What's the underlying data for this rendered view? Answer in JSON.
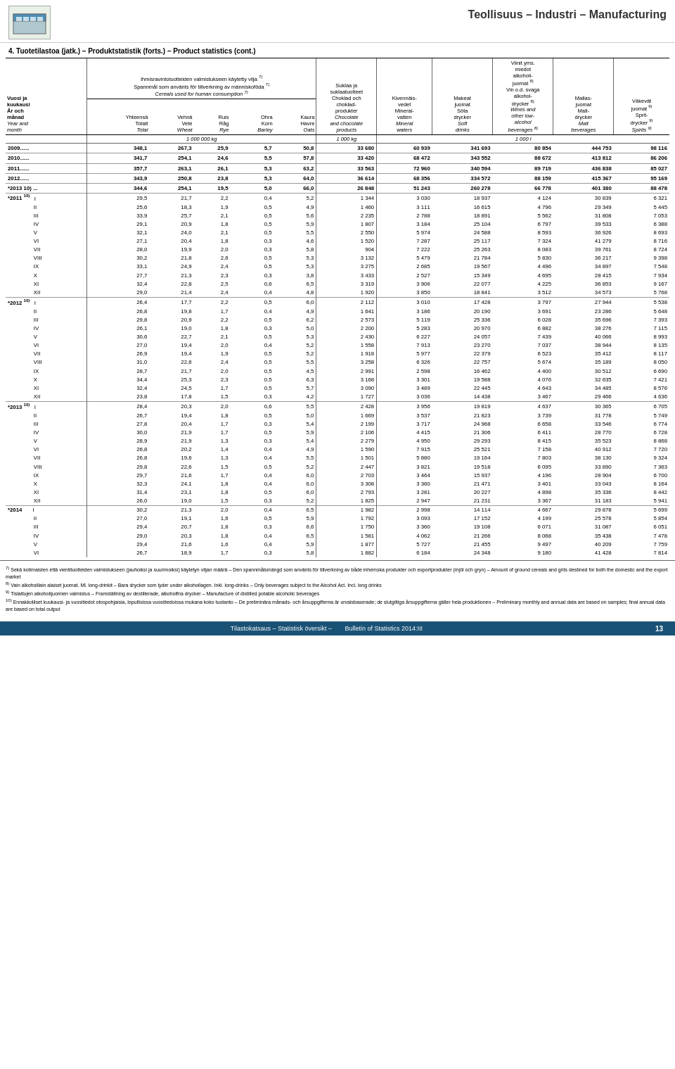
{
  "header": {
    "title": "Teollisuus – Industri – Manufacturing",
    "page_title": "4.  Tuotetilastoa (jatk.) – Produktstatistik (forts.) – Product statistics (cont.)"
  },
  "columns": {
    "year_month": {
      "fi": "Vuosi ja kuukausi",
      "sv": "År och månad",
      "en": "Year and month"
    },
    "total": {
      "fi": "Yhteensä Totalt",
      "sv": "Total",
      "en": "Total"
    },
    "wheat": {
      "fi": "Vehnä Vete",
      "sv": "Wheat"
    },
    "rye": {
      "fi": "Ruis Råg",
      "sv": "Rye"
    },
    "barley": {
      "fi": "Ohra Korn",
      "sv": "Barley"
    },
    "oats": {
      "fi": "Kaura Havre",
      "sv": "Oats"
    },
    "chocolate": {
      "fi": "Suklaa ja suklaatuotteet Choklad och chokladprodukter",
      "en": "Chocolate and chocolate products"
    },
    "mineral": {
      "fi": "Kivennäisvedet Mineralvatten",
      "en": "Mineral waters"
    },
    "soft": {
      "fi": "Makeat juomat Söta drycker",
      "en": "Soft drinks"
    },
    "wines": {
      "fi": "Viinit yms. miedot alkoholijuomat",
      "en": "Wines and other low-alcohol beverages"
    },
    "malt": {
      "fi": "Mallasjuomat Malt-drycker",
      "en": "Malt beverages"
    },
    "spirits": {
      "fi": "Väkevät juomat",
      "en": "Spirits"
    }
  },
  "units": {
    "cereals": "1 000 000 kg",
    "chocolate": "1 000 kg",
    "beverages": "1 000 l"
  },
  "data": {
    "years": [
      {
        "year": "2009......",
        "total": "348,1",
        "wheat": "267,3",
        "rye": "25,9",
        "barley": "5,7",
        "oats": "50,8",
        "chocolate": "33 680",
        "mineral": "60 939",
        "soft": "341 693",
        "wines": "80 854",
        "malt": "444 753",
        "spirits": "98 116"
      },
      {
        "year": "2010......",
        "total": "341,7",
        "wheat": "254,1",
        "rye": "24,6",
        "barley": "5,5",
        "oats": "57,8",
        "chocolate": "33 420",
        "mineral": "68 472",
        "soft": "343 552",
        "wines": "88 672",
        "malt": "413 812",
        "spirits": "86 206"
      },
      {
        "year": "2011......",
        "total": "357,7",
        "wheat": "263,1",
        "rye": "26,1",
        "barley": "5,3",
        "oats": "63,2",
        "chocolate": "33 563",
        "mineral": "72 960",
        "soft": "340 594",
        "wines": "89 719",
        "malt": "436 838",
        "spirits": "85 027"
      },
      {
        "year": "2012......",
        "total": "343,9",
        "wheat": "250,8",
        "rye": "23,8",
        "barley": "5,3",
        "oats": "64,0",
        "chocolate": "36 614",
        "mineral": "68 356",
        "soft": "334 572",
        "wines": "88 159",
        "malt": "415 367",
        "spirits": "95 169"
      },
      {
        "year": "*2013 10) ...",
        "total": "344,6",
        "wheat": "254,1",
        "rye": "19,5",
        "barley": "5,0",
        "oats": "66,0",
        "chocolate": "26 848",
        "mineral": "51 243",
        "soft": "260 278",
        "wines": "66 778",
        "malt": "401 380",
        "spirits": "88 478"
      }
    ],
    "months_2011": [
      {
        "month": "I",
        "total": "29,5",
        "wheat": "21,7",
        "rye": "2,2",
        "barley": "0,4",
        "oats": "5,2",
        "chocolate": "1 344",
        "mineral": "3 030",
        "soft": "18 937",
        "wines": "4 124",
        "malt": "30 839",
        "spirits": "6 321"
      },
      {
        "month": "II",
        "total": "25,6",
        "wheat": "18,3",
        "rye": "1,9",
        "barley": "0,5",
        "oats": "4,9",
        "chocolate": "1 460",
        "mineral": "3 111",
        "soft": "16 615",
        "wines": "4 796",
        "malt": "29 349",
        "spirits": "5 445"
      },
      {
        "month": "III",
        "total": "33,9",
        "wheat": "25,7",
        "rye": "2,1",
        "barley": "0,5",
        "oats": "5,6",
        "chocolate": "2 235",
        "mineral": "2 788",
        "soft": "18 891",
        "wines": "5 562",
        "malt": "31 808",
        "spirits": "7 053"
      },
      {
        "month": "IV",
        "total": "29,1",
        "wheat": "20,9",
        "rye": "1,8",
        "barley": "0,5",
        "oats": "5,9",
        "chocolate": "1 807",
        "mineral": "3 184",
        "soft": "25 104",
        "wines": "6 797",
        "malt": "39 533",
        "spirits": "6 388"
      },
      {
        "month": "V",
        "total": "32,1",
        "wheat": "24,0",
        "rye": "2,1",
        "barley": "0,5",
        "oats": "5,5",
        "chocolate": "2 550",
        "mineral": "5 974",
        "soft": "24 588",
        "wines": "8 593",
        "malt": "36 926",
        "spirits": "8 693"
      },
      {
        "month": "VI",
        "total": "27,1",
        "wheat": "20,4",
        "rye": "1,8",
        "barley": "0,3",
        "oats": "4,6",
        "chocolate": "1 520",
        "mineral": "7 287",
        "soft": "25 117",
        "wines": "7 324",
        "malt": "41 279",
        "spirits": "8 716"
      },
      {
        "month": "VII",
        "total": "28,0",
        "wheat": "19,9",
        "rye": "2,0",
        "barley": "0,3",
        "oats": "5,8",
        "chocolate": "904",
        "mineral": "7 222",
        "soft": "25 263",
        "wines": "8 083",
        "malt": "39 761",
        "spirits": "8 724"
      },
      {
        "month": "VIII",
        "total": "30,2",
        "wheat": "21,8",
        "rye": "2,6",
        "barley": "0,5",
        "oats": "5,3",
        "chocolate": "3 132",
        "mineral": "5 479",
        "soft": "21 784",
        "wines": "5 830",
        "malt": "36 217",
        "spirits": "9 398"
      },
      {
        "month": "IX",
        "total": "33,1",
        "wheat": "24,9",
        "rye": "2,4",
        "barley": "0,5",
        "oats": "5,3",
        "chocolate": "3 275",
        "mineral": "2 685",
        "soft": "19 567",
        "wines": "4 496",
        "malt": "34 897",
        "spirits": "7 548"
      },
      {
        "month": "X",
        "total": "27,7",
        "wheat": "21,3",
        "rye": "2,3",
        "barley": "0,3",
        "oats": "3,8",
        "chocolate": "3 433",
        "mineral": "2 527",
        "soft": "15 349",
        "wines": "4 695",
        "malt": "28 415",
        "spirits": "7 934"
      },
      {
        "month": "XI",
        "total": "32,4",
        "wheat": "22,8",
        "rye": "2,5",
        "barley": "0,6",
        "oats": "6,5",
        "chocolate": "3 319",
        "mineral": "3 906",
        "soft": "22 077",
        "wines": "4 225",
        "malt": "36 853",
        "spirits": "9 167"
      },
      {
        "month": "XII",
        "total": "29,0",
        "wheat": "21,4",
        "rye": "2,4",
        "barley": "0,4",
        "oats": "4,8",
        "chocolate": "1 920",
        "mineral": "3 850",
        "soft": "18 841",
        "wines": "3 512",
        "malt": "34 573",
        "spirits": "5 768"
      }
    ],
    "months_2012": [
      {
        "month": "I",
        "total": "26,4",
        "wheat": "17,7",
        "rye": "2,2",
        "barley": "0,5",
        "oats": "6,0",
        "chocolate": "2 112",
        "mineral": "3 010",
        "soft": "17 428",
        "wines": "3 797",
        "malt": "27 944",
        "spirits": "5 538"
      },
      {
        "month": "II",
        "total": "26,8",
        "wheat": "19,8",
        "rye": "1,7",
        "barley": "0,4",
        "oats": "4,9",
        "chocolate": "1 641",
        "mineral": "3 186",
        "soft": "20 190",
        "wines": "3 691",
        "malt": "23 286",
        "spirits": "5 648"
      },
      {
        "month": "III",
        "total": "29,8",
        "wheat": "20,9",
        "rye": "2,2",
        "barley": "0,5",
        "oats": "6,2",
        "chocolate": "2 573",
        "mineral": "5 119",
        "soft": "25 336",
        "wines": "6 028",
        "malt": "35 696",
        "spirits": "7 393"
      },
      {
        "month": "IV",
        "total": "26,1",
        "wheat": "19,0",
        "rye": "1,8",
        "barley": "0,3",
        "oats": "5,0",
        "chocolate": "2 200",
        "mineral": "5 283",
        "soft": "20 970",
        "wines": "6 882",
        "malt": "38 276",
        "spirits": "7 115"
      },
      {
        "month": "V",
        "total": "30,6",
        "wheat": "22,7",
        "rye": "2,1",
        "barley": "0,5",
        "oats": "5,3",
        "chocolate": "2 430",
        "mineral": "6 227",
        "soft": "24 057",
        "wines": "7 439",
        "malt": "40 066",
        "spirits": "8 993"
      },
      {
        "month": "VI",
        "total": "27,0",
        "wheat": "19,4",
        "rye": "2,0",
        "barley": "0,4",
        "oats": "5,2",
        "chocolate": "1 558",
        "mineral": "7 913",
        "soft": "23 270",
        "wines": "7 037",
        "malt": "38 944",
        "spirits": "8 135"
      },
      {
        "month": "VII",
        "total": "26,9",
        "wheat": "19,4",
        "rye": "1,9",
        "barley": "0,5",
        "oats": "5,2",
        "chocolate": "1 918",
        "mineral": "5 977",
        "soft": "22 379",
        "wines": "6 523",
        "malt": "35 412",
        "spirits": "8 117"
      },
      {
        "month": "VIII",
        "total": "31,0",
        "wheat": "22,6",
        "rye": "2,4",
        "barley": "0,5",
        "oats": "5,5",
        "chocolate": "3 258",
        "mineral": "6 326",
        "soft": "22 757",
        "wines": "5 674",
        "malt": "35 189",
        "spirits": "8 050"
      },
      {
        "month": "IX",
        "total": "28,7",
        "wheat": "21,7",
        "rye": "2,0",
        "barley": "0,5",
        "oats": "4,5",
        "chocolate": "2 991",
        "mineral": "2 598",
        "soft": "16 462",
        "wines": "4 400",
        "malt": "30 512",
        "spirits": "6 690"
      },
      {
        "month": "X",
        "total": "34,4",
        "wheat": "25,3",
        "rye": "2,3",
        "barley": "0,5",
        "oats": "6,3",
        "chocolate": "3 168",
        "mineral": "3 301",
        "soft": "19 588",
        "wines": "4 076",
        "malt": "32 635",
        "spirits": "7 421"
      },
      {
        "month": "XI",
        "total": "32,4",
        "wheat": "24,5",
        "rye": "1,7",
        "barley": "0,5",
        "oats": "5,7",
        "chocolate": "3 090",
        "mineral": "3 489",
        "soft": "22 445",
        "wines": "4 643",
        "malt": "34 485",
        "spirits": "8 576"
      },
      {
        "month": "XII",
        "total": "23,8",
        "wheat": "17,8",
        "rye": "1,5",
        "barley": "0,3",
        "oats": "4,2",
        "chocolate": "1 727",
        "mineral": "3 036",
        "soft": "14 438",
        "wines": "3 467",
        "malt": "29 466",
        "spirits": "4 636"
      }
    ],
    "months_2013": [
      {
        "month": "I",
        "total": "28,4",
        "wheat": "20,3",
        "rye": "2,0",
        "barley": "0,6",
        "oats": "5,5",
        "chocolate": "2 428",
        "mineral": "3 956",
        "soft": "19 819",
        "wines": "4 637",
        "malt": "30 365",
        "spirits": "6 705"
      },
      {
        "month": "II",
        "total": "26,7",
        "wheat": "19,4",
        "rye": "1,8",
        "barley": "0,5",
        "oats": "5,0",
        "chocolate": "1 669",
        "mineral": "3 537",
        "soft": "21 823",
        "wines": "3 739",
        "malt": "31 778",
        "spirits": "5 749"
      },
      {
        "month": "III",
        "total": "27,8",
        "wheat": "20,4",
        "rye": "1,7",
        "barley": "0,3",
        "oats": "5,4",
        "chocolate": "2 199",
        "mineral": "3 717",
        "soft": "24 968",
        "wines": "6 658",
        "malt": "33 546",
        "spirits": "6 774"
      },
      {
        "month": "IV",
        "total": "30,0",
        "wheat": "21,9",
        "rye": "1,7",
        "barley": "0,5",
        "oats": "5,9",
        "chocolate": "2 106",
        "mineral": "4 415",
        "soft": "21 306",
        "wines": "6 411",
        "malt": "28 770",
        "spirits": "6 728"
      },
      {
        "month": "V",
        "total": "28,9",
        "wheat": "21,9",
        "rye": "1,3",
        "barley": "0,3",
        "oats": "5,4",
        "chocolate": "2 279",
        "mineral": "4 950",
        "soft": "29 293",
        "wines": "8 415",
        "malt": "35 523",
        "spirits": "8 868"
      },
      {
        "month": "VI",
        "total": "26,8",
        "wheat": "20,2",
        "rye": "1,4",
        "barley": "0,4",
        "oats": "4,9",
        "chocolate": "1 590",
        "mineral": "7 915",
        "soft": "25 521",
        "wines": "7 158",
        "malt": "40 912",
        "spirits": "7 720"
      },
      {
        "month": "VII",
        "total": "26,8",
        "wheat": "19,6",
        "rye": "1,3",
        "barley": "0,4",
        "oats": "5,5",
        "chocolate": "1 501",
        "mineral": "5 880",
        "soft": "19 164",
        "wines": "7 803",
        "malt": "38 130",
        "spirits": "9 324"
      },
      {
        "month": "VIII",
        "total": "29,8",
        "wheat": "22,6",
        "rye": "1,5",
        "barley": "0,5",
        "oats": "5,2",
        "chocolate": "2 447",
        "mineral": "3 821",
        "soft": "19 518",
        "wines": "6 095",
        "malt": "33 890",
        "spirits": "7 363"
      },
      {
        "month": "IX",
        "total": "29,7",
        "wheat": "21,6",
        "rye": "1,7",
        "barley": "0,4",
        "oats": "6,0",
        "chocolate": "2 703",
        "mineral": "3 464",
        "soft": "15 937",
        "wines": "4 196",
        "malt": "28 904",
        "spirits": "6 700"
      },
      {
        "month": "X",
        "total": "32,3",
        "wheat": "24,1",
        "rye": "1,8",
        "barley": "0,4",
        "oats": "6,0",
        "chocolate": "3 308",
        "mineral": "3 360",
        "soft": "21 471",
        "wines": "3 401",
        "malt": "33 043",
        "spirits": "8 164"
      },
      {
        "month": "XI",
        "total": "31,4",
        "wheat": "23,1",
        "rye": "1,8",
        "barley": "0,5",
        "oats": "6,0",
        "chocolate": "2 793",
        "mineral": "3 281",
        "soft": "20 227",
        "wines": "4 898",
        "malt": "35 336",
        "spirits": "8 442"
      },
      {
        "month": "XII",
        "total": "26,0",
        "wheat": "19,0",
        "rye": "1,5",
        "barley": "0,3",
        "oats": "5,2",
        "chocolate": "1 825",
        "mineral": "2 947",
        "soft": "21 231",
        "wines": "3 367",
        "malt": "31 183",
        "spirits": "5 941"
      }
    ],
    "months_2014": [
      {
        "month": "I",
        "total": "30,2",
        "wheat": "21,3",
        "rye": "2,0",
        "barley": "0,4",
        "oats": "6,5",
        "chocolate": "1 982",
        "mineral": "2 998",
        "soft": "14 114",
        "wines": "4 667",
        "malt": "29 878",
        "spirits": "5 699"
      },
      {
        "month": "II",
        "total": "27,0",
        "wheat": "19,1",
        "rye": "1,6",
        "barley": "0,5",
        "oats": "5,9",
        "chocolate": "1 792",
        "mineral": "3 093",
        "soft": "17 152",
        "wines": "4 199",
        "malt": "25 578",
        "spirits": "5 854"
      },
      {
        "month": "III",
        "total": "29,4",
        "wheat": "20,7",
        "rye": "1,8",
        "barley": "0,3",
        "oats": "6,6",
        "chocolate": "1 750",
        "mineral": "3 360",
        "soft": "19 108",
        "wines": "6 071",
        "malt": "31 087",
        "spirits": "6 051"
      },
      {
        "month": "IV",
        "total": "29,0",
        "wheat": "20,3",
        "rye": "1,8",
        "barley": "0,4",
        "oats": "6,5",
        "chocolate": "1 581",
        "mineral": "4 062",
        "soft": "21 266",
        "wines": "8 068",
        "malt": "35 438",
        "spirits": "7 478"
      },
      {
        "month": "V",
        "total": "29,4",
        "wheat": "21,6",
        "rye": "1,6",
        "barley": "0,4",
        "oats": "5,9",
        "chocolate": "1 877",
        "mineral": "5 727",
        "soft": "21 455",
        "wines": "9 497",
        "malt": "40 209",
        "spirits": "7 759"
      },
      {
        "month": "VI",
        "total": "26,7",
        "wheat": "18,9",
        "rye": "1,7",
        "barley": "0,3",
        "oats": "5,8",
        "chocolate": "1 882",
        "mineral": "6 184",
        "soft": "24 348",
        "wines": "9 180",
        "malt": "41 428",
        "spirits": "7 814"
      }
    ]
  },
  "footnotes": {
    "fn7": "Sekä kotimaisten että vientituotteiden valmistukseen (jauhoiksi ja suurimoiksi) käytetyn viljan määrä – Den spannmålsmängd som använts för tillverkning av både inhemska produkter och exportprodukter (mjöl och gryn) – Amount of ground cereals and grits destined for both the domestic and the export market",
    "fn8": "Vain alkoholilain alaiset juomat. Ml. long-drinkit – Bara drycker som lyder under alkohollagen. Inkl. long-drinks – Only beverages subject to the Alcohol Act. Incl. long drinks",
    "fn9": "Tislattujen alkoholijuomien valmistus – Framställning av destillerade, alkoholfria drycker – Manufacture of distilled potable alcoholic beverages",
    "fn10": "Ennakkolliset kuukausi- ja vuositiedot otospohjaisia, lopullisissa vuositiedoissa mukana koko tuotanto – De preliminära månads- och årsuppgifterna är urvalsbaserade; de slutgiltiga årsuppgifterna gäller hela produktionen – Preliminary monthly and annual data are based on samples; final annual data are based on total output"
  },
  "footer": {
    "text1": "Tilastokatsaus – Statistisk översikt –",
    "text2": "Bulletin of Statistics 2014:III",
    "page": "13"
  }
}
